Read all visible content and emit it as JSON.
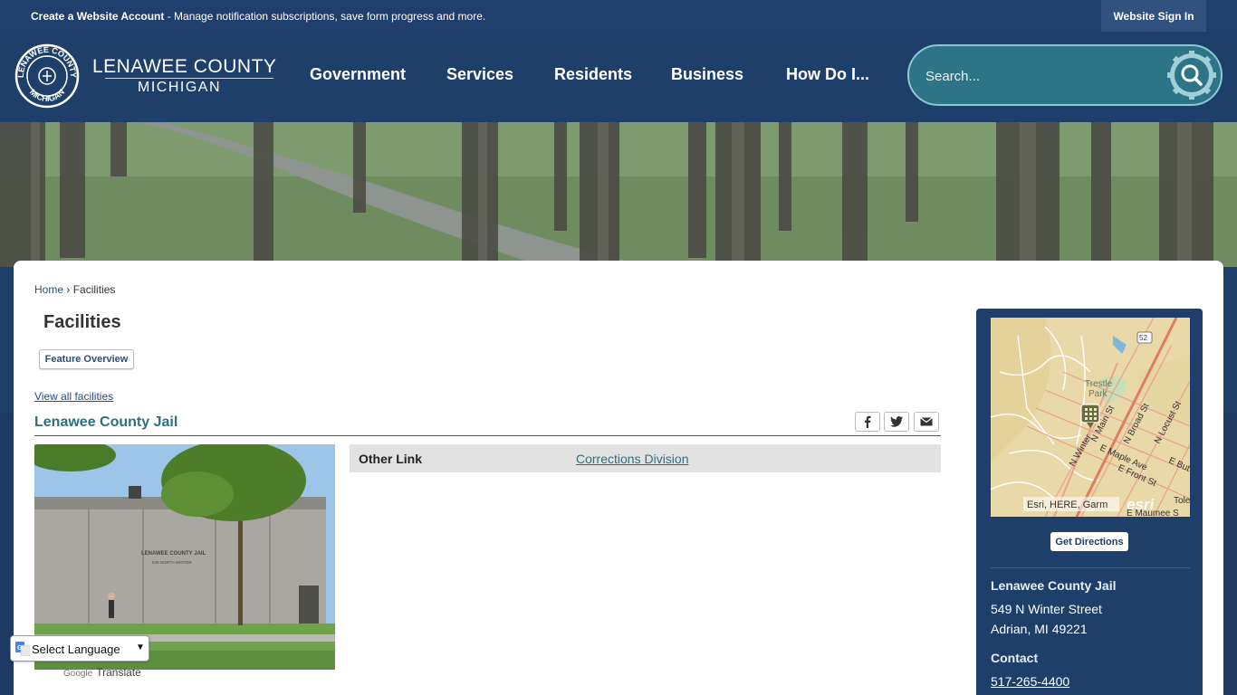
{
  "topbar": {
    "account_bold": "Create a Website Account",
    "account_rest": " - Manage notification subscriptions, save form progress and more.",
    "signin": "Website Sign In"
  },
  "header": {
    "brand_line1": "LENAWEE COUNTY",
    "brand_line2": "MICHIGAN",
    "seal_top": "LENAWEE COUNTY",
    "seal_bottom": "MICHIGAN",
    "nav": [
      "Government",
      "Services",
      "Residents",
      "Business",
      "How Do I..."
    ],
    "search_placeholder": "Search..."
  },
  "breadcrumb": {
    "home": "Home",
    "sep": "›",
    "current": "Facilities"
  },
  "page_title": "Facilities",
  "feature_button": "Feature Overview",
  "view_all": "View all facilities",
  "facility": {
    "name": "Lenawee County Jail",
    "photo_sign1": "LENAWEE COUNTY JAIL",
    "photo_sign2": "549 NORTH WINTER",
    "link_label": "Other Link",
    "link_value": "Corrections Division"
  },
  "sidebar": {
    "map_labels": {
      "park": "Trestle",
      "park2": "Park",
      "route": "52",
      "winter": "N Winter",
      "main": "N Main St",
      "broad": "N Broad St",
      "locust": "N Locust St",
      "maple": "E Maple Ave",
      "front": "E Front St",
      "toledo": "Toledo",
      "maumee": "E Maumee S",
      "but": "E But"
    },
    "map_attribution": "Esri, HERE, Garm",
    "map_logo": "esri",
    "directions": "Get Directions",
    "name": "Lenawee County Jail",
    "address1": "549 N Winter Street",
    "address2": "Adrian, MI 49221",
    "contact_label": "Contact",
    "phone": "517-265-4400"
  },
  "translate": {
    "select": "Select Language",
    "powered_logo": "Google",
    "powered": "Translate"
  }
}
